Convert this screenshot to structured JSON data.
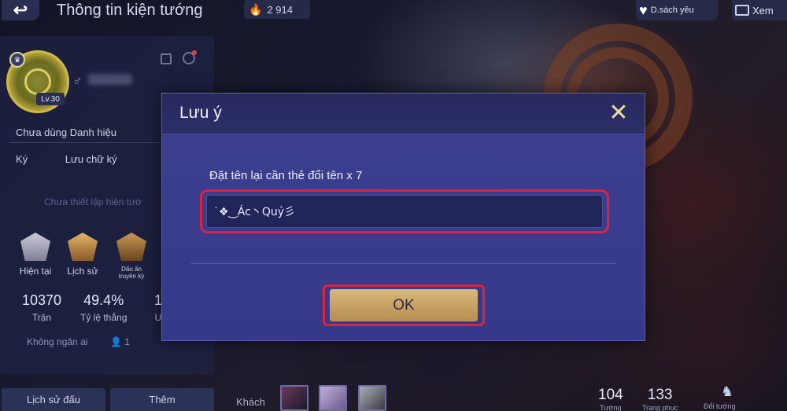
{
  "header": {
    "back_icon": "back-arrow-icon",
    "title": "Thông tin kiện tướng",
    "gold": "2 914",
    "favorites_label": "D.sách yêu",
    "view_label": "Xem"
  },
  "profile": {
    "level": "Lv.30",
    "title_status": "Chưa dùng Danh hiệu",
    "signature_label": "Ký",
    "signature_value": "Lưu chữ ký",
    "unset_text": "Chưa thiết lập hiện tướ",
    "ranks": [
      {
        "label": "Hiện tại"
      },
      {
        "label": "Lịch sử"
      },
      {
        "label": "Dấu ấn truyền kỳ"
      }
    ],
    "stats": [
      {
        "value": "10370",
        "label": "Trận"
      },
      {
        "value": "49.4%",
        "label": "Tỷ lệ thắng"
      },
      {
        "value": "1",
        "label": "U"
      }
    ],
    "friend_status": "Không ngăn ai",
    "friend_count": "1"
  },
  "bottom": {
    "history_button": "Lịch sử đấu",
    "more_button": "Thêm",
    "guest_label": "Khách",
    "heroes_count": "104",
    "heroes_label": "Tướng",
    "skins_count": "133",
    "skins_label": "Trang phục",
    "swap_label": "Đổi tướng"
  },
  "dialog": {
    "title": "Lưu ý",
    "close_icon": "close-icon",
    "prompt": "Đặt tên lại cần thẻ đổi tên x 7",
    "input_value": "˙❖‿Ác丶Quỷ彡",
    "ok_label": "OK"
  },
  "colors": {
    "dialog_bg": "#3d3f8e",
    "ok_button": "#d9b97e",
    "highlight": "#d8243f"
  }
}
